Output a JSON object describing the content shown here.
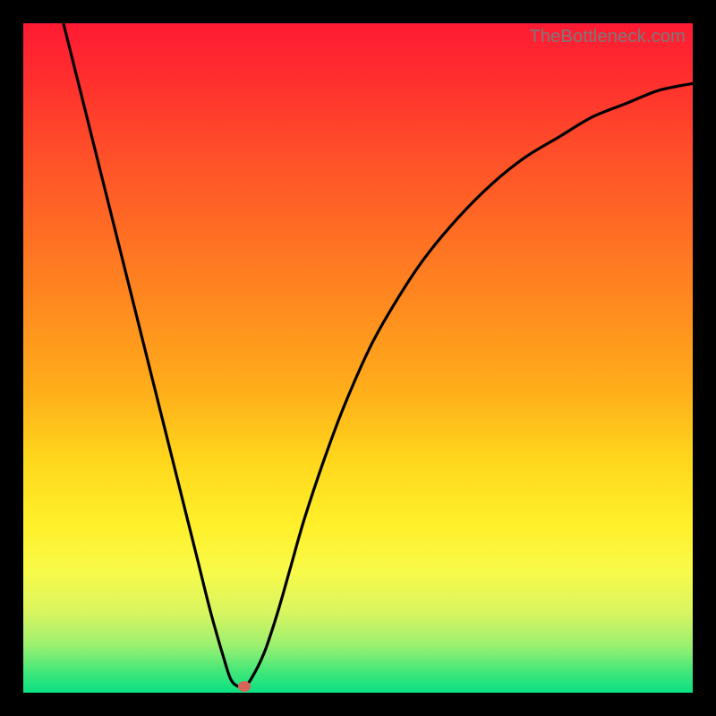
{
  "credit": "TheBottleneck.com",
  "chart_data": {
    "type": "line",
    "title": "",
    "xlabel": "",
    "ylabel": "",
    "xlim": [
      0,
      100
    ],
    "ylim": [
      0,
      100
    ],
    "grid": false,
    "legend": false,
    "series": [
      {
        "name": "curve",
        "x": [
          6,
          8,
          10,
          12,
          14,
          16,
          18,
          20,
          22,
          24,
          26,
          28,
          30,
          31,
          32,
          33,
          34,
          36,
          38,
          40,
          42,
          45,
          48,
          52,
          56,
          60,
          65,
          70,
          75,
          80,
          85,
          90,
          95,
          100
        ],
        "values": [
          100,
          92,
          84,
          76,
          68,
          60,
          52,
          44,
          36,
          28,
          20,
          12,
          5,
          2,
          1,
          1,
          2,
          6,
          12,
          19,
          26,
          35,
          43,
          52,
          59,
          65,
          71,
          76,
          80,
          83,
          86,
          88,
          90,
          91
        ]
      }
    ],
    "marker": {
      "x": 33,
      "y": 1,
      "color": "#d9645a"
    },
    "gradient_stops": [
      {
        "pos": 0,
        "color": "#ff1a33"
      },
      {
        "pos": 50,
        "color": "#ffb81c"
      },
      {
        "pos": 80,
        "color": "#fff02a"
      },
      {
        "pos": 100,
        "color": "#0ae082"
      }
    ]
  }
}
